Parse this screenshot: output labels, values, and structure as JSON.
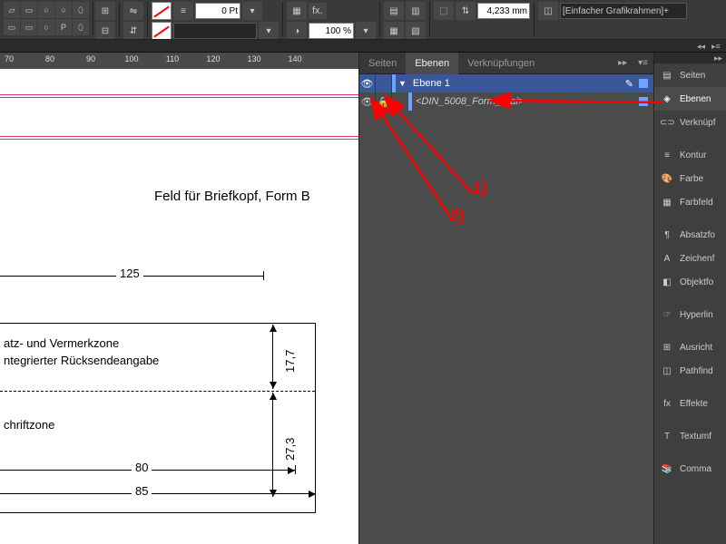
{
  "toolbar": {
    "stroke_pt": "0 Pt",
    "zoom": "100 %",
    "fx_label": "fx.",
    "crop_value": "4,233 mm",
    "style_select": "[Einfacher Grafikrahmen]+"
  },
  "ruler": {
    "ticks": [
      "70",
      "80",
      "90",
      "100",
      "110",
      "120",
      "130",
      "140"
    ]
  },
  "document": {
    "heading": "Feld für Briefkopf, Form B",
    "dim_125": "125",
    "zone1_line1": "atz- und Vermerkzone",
    "zone1_line2": "ntegrierter Rücksendeangabe",
    "zone2": "chriftzone",
    "dim_v1": "17,7",
    "dim_v2": "27,3",
    "dim_80": "80",
    "dim_85": "85"
  },
  "panel": {
    "tab_seiten": "Seiten",
    "tab_ebenen": "Ebenen",
    "tab_verknuepf": "Verknüpfungen",
    "layer1": "Ebene 1",
    "placed": "<DIN_5008_Form_B.ai>"
  },
  "dock": {
    "items": [
      {
        "icon": "▤",
        "label": "Seiten"
      },
      {
        "icon": "◈",
        "label": "Ebenen"
      },
      {
        "icon": "⊂⊃",
        "label": "Verknüpf"
      },
      {
        "icon": "≡",
        "label": "Kontur"
      },
      {
        "icon": "🎨",
        "label": "Farbe"
      },
      {
        "icon": "▦",
        "label": "Farbfeld"
      },
      {
        "icon": "¶",
        "label": "Absatzfo"
      },
      {
        "icon": "A",
        "label": "Zeichenf"
      },
      {
        "icon": "◧",
        "label": "Objektfo"
      },
      {
        "icon": "☞",
        "label": "Hyperlin"
      },
      {
        "icon": "⊞",
        "label": "Ausricht"
      },
      {
        "icon": "◫",
        "label": "Pathfind"
      },
      {
        "icon": "fx",
        "label": "Effekte"
      },
      {
        "icon": "T",
        "label": "Textumf"
      },
      {
        "icon": "📚",
        "label": "Comma"
      }
    ]
  },
  "annot": {
    "l1": "1)",
    "l2": "2)"
  }
}
